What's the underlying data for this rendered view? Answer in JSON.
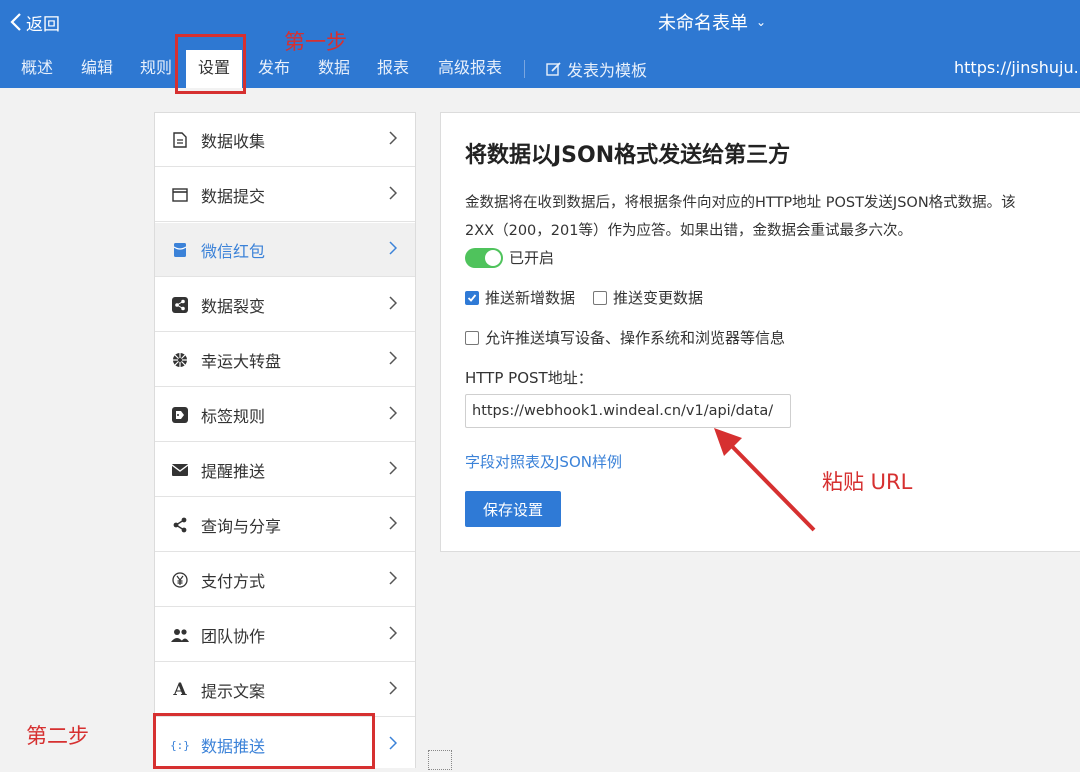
{
  "header": {
    "back_label": "返回",
    "form_title": "未命名表单",
    "tabs": [
      "概述",
      "编辑",
      "规则",
      "设置",
      "发布",
      "数据",
      "报表",
      "高级报表"
    ],
    "active_tab": "设置",
    "template_label": "发表为模板",
    "url": "https://jinshuju.n"
  },
  "sidebar": {
    "items": [
      {
        "label": "数据收集",
        "icon": "document-icon"
      },
      {
        "label": "数据提交",
        "icon": "window-icon"
      },
      {
        "label": "微信红包",
        "icon": "red-packet-icon"
      },
      {
        "label": "数据裂变",
        "icon": "share-box-icon"
      },
      {
        "label": "幸运大转盘",
        "icon": "wheel-icon"
      },
      {
        "label": "标签规则",
        "icon": "tag-icon"
      },
      {
        "label": "提醒推送",
        "icon": "mail-icon"
      },
      {
        "label": "查询与分享",
        "icon": "share-icon"
      },
      {
        "label": "支付方式",
        "icon": "yen-icon"
      },
      {
        "label": "团队协作",
        "icon": "team-icon"
      },
      {
        "label": "提示文案",
        "icon": "font-icon"
      },
      {
        "label": "数据推送",
        "icon": "braces-icon"
      }
    ],
    "selected": "微信红包"
  },
  "panel": {
    "title": "将数据以JSON格式发送给第三方",
    "desc_line1": "金数据将在收到数据后，将根据条件向对应的HTTP地址 POST发送JSON格式数据。该",
    "desc_line2": "2XX（200，201等）作为应答。如果出错，金数据会重试最多六次。",
    "toggle_label": "已开启",
    "toggle_on": true,
    "checkbox_new": {
      "label": "推送新增数据",
      "checked": true
    },
    "checkbox_change": {
      "label": "推送变更数据",
      "checked": false
    },
    "checkbox_device": {
      "label": "允许推送填写设备、操作系统和浏览器等信息",
      "checked": false
    },
    "post_label": "HTTP POST地址：",
    "post_url": "https://webhook1.windeal.cn/v1/api/data/",
    "field_link": "字段对照表及JSON样例",
    "save_label": "保存设置"
  },
  "annotations": {
    "step1": "第一步",
    "step2": "第二步",
    "paste": "粘贴 URL"
  },
  "colors": {
    "header_bg": "#2e78d2",
    "accent": "#2f7ad6",
    "toggle_on": "#4fc35c",
    "annotation_red": "#d63030"
  }
}
